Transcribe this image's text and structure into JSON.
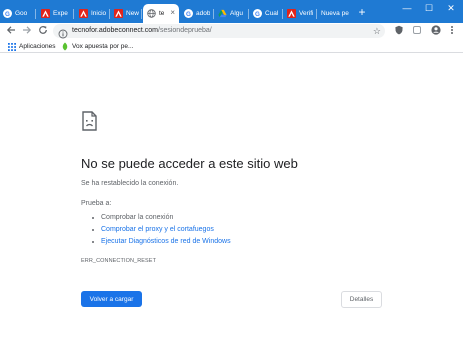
{
  "browser": {
    "tabs": [
      {
        "title": "Goo",
        "icon": "google-g-icon",
        "active": false
      },
      {
        "title": "Expe",
        "icon": "adobe-icon",
        "active": false
      },
      {
        "title": "Inicio",
        "icon": "adobe-icon",
        "active": false
      },
      {
        "title": "New",
        "icon": "adobe-icon",
        "active": false
      },
      {
        "title": "te",
        "icon": "globe-icon",
        "active": true,
        "close": "×"
      },
      {
        "title": "adob",
        "icon": "google-g-icon",
        "active": false
      },
      {
        "title": "Algu",
        "icon": "google-drive-icon",
        "active": false
      },
      {
        "title": "Cual",
        "icon": "google-g-icon",
        "active": false
      },
      {
        "title": "Verifi",
        "icon": "adobe-icon",
        "active": false
      },
      {
        "title": "Nueva pe",
        "icon": "",
        "active": false
      }
    ],
    "new_tab": "+",
    "window_controls": {
      "minimize": "—",
      "maximize": "☐",
      "close": "✕"
    },
    "toolbar": {
      "url_host": "tecnofor.adobeconnect.com",
      "url_path": "/sesiondeprueba/"
    },
    "bookmarks": [
      {
        "label": "Aplicaciones",
        "icon": "apps-grid-icon"
      },
      {
        "label": "Vox apuesta por pe...",
        "icon": "vox-leaf-icon"
      }
    ]
  },
  "error_page": {
    "heading": "No se puede acceder a este sitio web",
    "message": "Se ha restablecido la conexión.",
    "try_label": "Prueba a:",
    "suggestions": [
      "Comprobar la conexión",
      "Comprobar el proxy y el cortafuegos",
      "Ejecutar Diagnósticos de red de Windows"
    ],
    "error_code": "ERR_CONNECTION_RESET",
    "reload_button": "Volver a cargar",
    "details_button": "Detalles"
  },
  "colors": {
    "titlebar": "#1f7ad3",
    "adobe_red": "#e1251b",
    "link_blue": "#1a73e8",
    "primary_button": "#1a73e8"
  }
}
